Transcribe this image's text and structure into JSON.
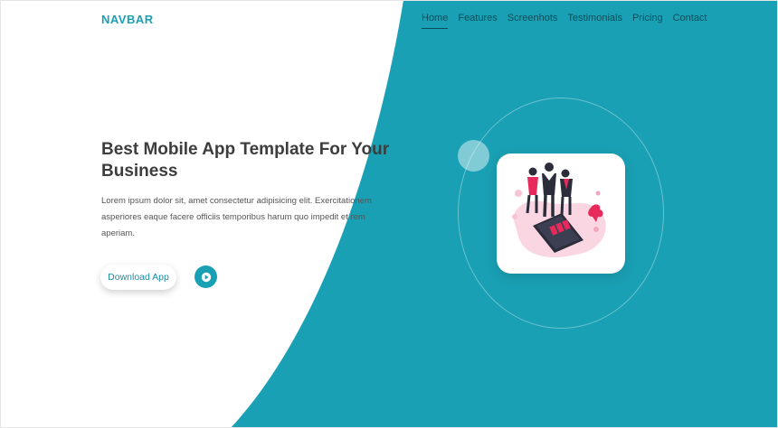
{
  "brand": {
    "logo_text": "NAVBAR"
  },
  "nav": {
    "items": [
      {
        "label": "Home",
        "active": true
      },
      {
        "label": "Features"
      },
      {
        "label": "Screenhots"
      },
      {
        "label": "Testimonials"
      },
      {
        "label": "Pricing"
      },
      {
        "label": "Contact"
      }
    ]
  },
  "hero": {
    "title": "Best Mobile App Template For Your Business",
    "description": "Lorem ipsum dolor sit, amet consectetur adipisicing elit. Exercitationem asperiores eaque facere officiis temporibus harum quo impedit et rem aperiam.",
    "download_label": "Download App",
    "play_icon": "play-icon"
  },
  "illustration": {
    "icon": "team-with-phone-illustration"
  },
  "colors": {
    "accent": "#1aa0b4",
    "nav_text": "#0b4f5c",
    "title": "#3d3d3d",
    "body_text": "#555555"
  }
}
